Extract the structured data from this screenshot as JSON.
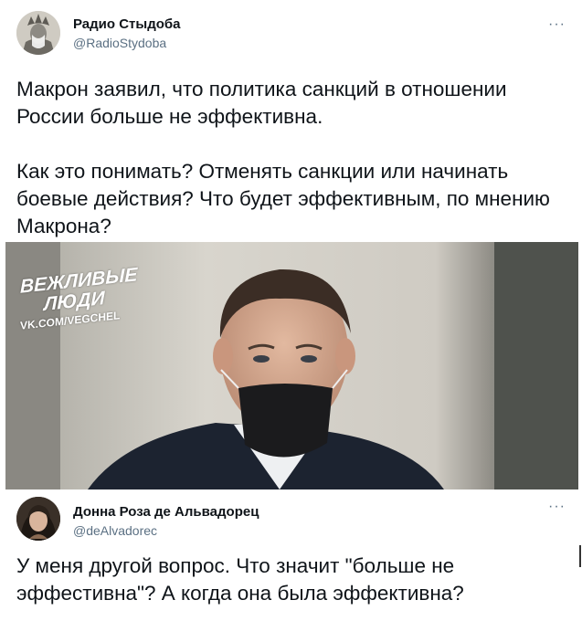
{
  "tweet1": {
    "display_name": "Радио Стыдоба",
    "handle": "@RadioStydoba",
    "more_icon": "more-horizontal-icon",
    "paragraphs": [
      "Макрон заявил, что политика санкций в отношении России больше не эффективна.",
      "Как это понимать? Отменять санкции или начинать боевые действия? Что будет эффективным, по мнению Макрона?"
    ],
    "image_watermark": {
      "line1": "ВЕЖЛИВЫЕ",
      "line2": "ЛЮДИ",
      "line3": "VK.COM/VEGCHEL"
    }
  },
  "tweet2": {
    "display_name": "Донна Роза де Альвадорец",
    "handle": "@deAlvadorec",
    "more_icon": "more-horizontal-icon",
    "text": "У меня другой вопрос. Что значит \"больше не эффестивна\"? А когда она была эффективна?"
  },
  "colors": {
    "text": "#0f1419",
    "secondary": "#5b7083",
    "background": "#ffffff"
  }
}
